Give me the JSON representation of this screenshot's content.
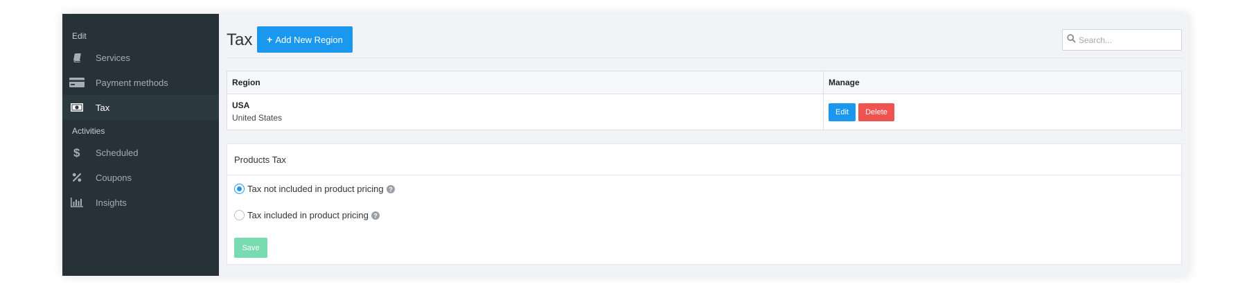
{
  "sidebar": {
    "sections": [
      {
        "title": "Edit",
        "items": [
          {
            "label": "Services",
            "icon": "book-icon",
            "active": false
          },
          {
            "label": "Payment methods",
            "icon": "credit-card-icon",
            "active": false
          },
          {
            "label": "Tax",
            "icon": "money-bill-icon",
            "active": true
          }
        ]
      },
      {
        "title": "Activities",
        "items": [
          {
            "label": "Scheduled",
            "icon": "dollar-icon",
            "active": false
          },
          {
            "label": "Coupons",
            "icon": "percent-icon",
            "active": false
          },
          {
            "label": "Insights",
            "icon": "bar-chart-icon",
            "active": false
          }
        ]
      }
    ]
  },
  "header": {
    "title": "Tax",
    "add_button_label": "Add New Region",
    "search_placeholder": "Search..."
  },
  "region_table": {
    "columns": [
      "Region",
      "Manage"
    ],
    "rows": [
      {
        "code": "USA",
        "name": "United States",
        "edit_label": "Edit",
        "delete_label": "Delete"
      }
    ]
  },
  "products_tax": {
    "title": "Products Tax",
    "options": [
      {
        "label": "Tax not included in product pricing",
        "selected": true
      },
      {
        "label": "Tax included in product pricing",
        "selected": false
      }
    ],
    "save_label": "Save"
  },
  "colors": {
    "sidebar_bg": "#263238",
    "primary": "#1a98f0",
    "danger": "#ef5350",
    "save_disabled": "#79dbb0"
  }
}
